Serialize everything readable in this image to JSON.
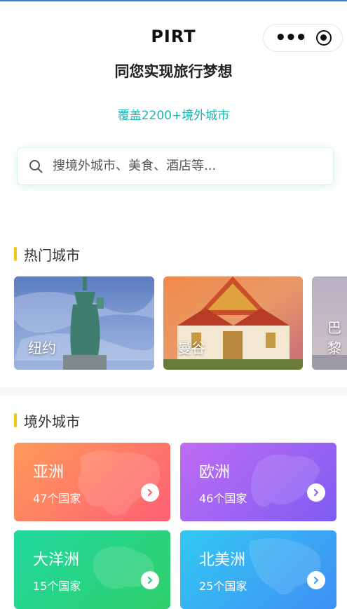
{
  "header": {
    "title": "PIRT"
  },
  "capsule": {
    "more_glyph": "•••",
    "close_icon": "target-icon"
  },
  "hero": {
    "subtitle": "同您实现旅行梦想",
    "coverage": "覆盖2200+境外城市"
  },
  "search": {
    "icon": "search-icon",
    "placeholder": "搜境外城市、美食、酒店等..."
  },
  "hot_cities": {
    "title": "热门城市",
    "items": [
      {
        "name": "纽约"
      },
      {
        "name": "曼谷"
      },
      {
        "name": "巴黎"
      }
    ]
  },
  "overseas": {
    "title": "境外城市",
    "regions": [
      {
        "name": "亚洲",
        "count": "47个国家",
        "gradient": [
          "#ff9a5a",
          "#ff5f74"
        ]
      },
      {
        "name": "欧洲",
        "count": "46个国家",
        "gradient": [
          "#c06cf5",
          "#7d5cf2"
        ]
      },
      {
        "name": "大洋洲",
        "count": "15个国家",
        "gradient": [
          "#22d8a0",
          "#2fcf6a"
        ]
      },
      {
        "name": "北美洲",
        "count": "25个国家",
        "gradient": [
          "#33c8f2",
          "#3f8ff5"
        ]
      }
    ]
  },
  "colors": {
    "accent_teal": "#22b3ad",
    "section_bar": "#f5c518",
    "chevron_asia": "#ff6a6a",
    "chevron_europe": "#9b63f2",
    "chevron_oceania": "#2fcf7a",
    "chevron_namerica": "#3f9ff5"
  }
}
